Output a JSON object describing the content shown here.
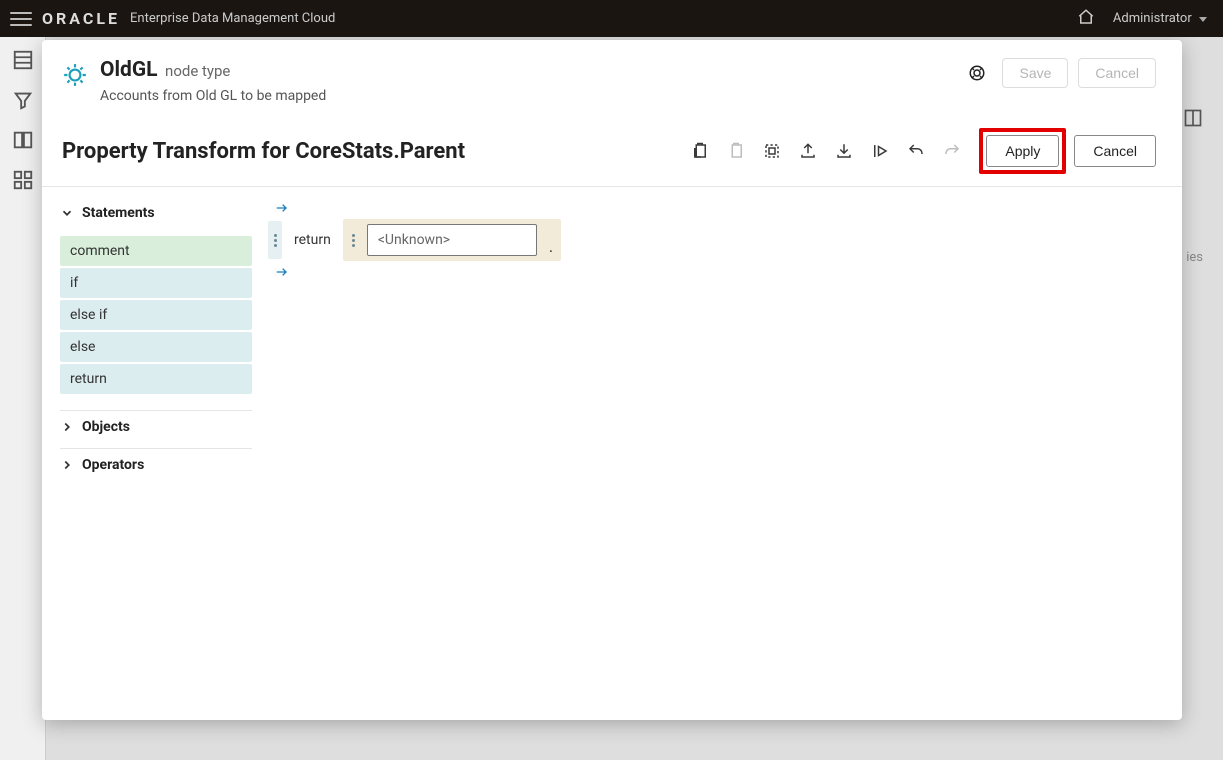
{
  "header": {
    "brand": "ORACLE",
    "product": "Enterprise Data Management Cloud",
    "user": "Administrator"
  },
  "background": {
    "right_hint": "ies"
  },
  "modal": {
    "title_main": "OldGL",
    "title_suffix": "node type",
    "subtitle": "Accounts from Old GL to be mapped",
    "save": "Save",
    "cancel_top": "Cancel",
    "section_title": "Property Transform for CoreStats.Parent",
    "apply": "Apply",
    "cancel_action": "Cancel"
  },
  "palette": {
    "groups": {
      "statements": {
        "label": "Statements",
        "expanded": true
      },
      "objects": {
        "label": "Objects",
        "expanded": false
      },
      "operators": {
        "label": "Operators",
        "expanded": false
      }
    },
    "statements": {
      "comment": "comment",
      "if": "if",
      "elseif": "else if",
      "else": "else",
      "return": "return"
    }
  },
  "canvas": {
    "return_kw": "return",
    "unknown_placeholder": "<Unknown>",
    "terminator": "."
  }
}
